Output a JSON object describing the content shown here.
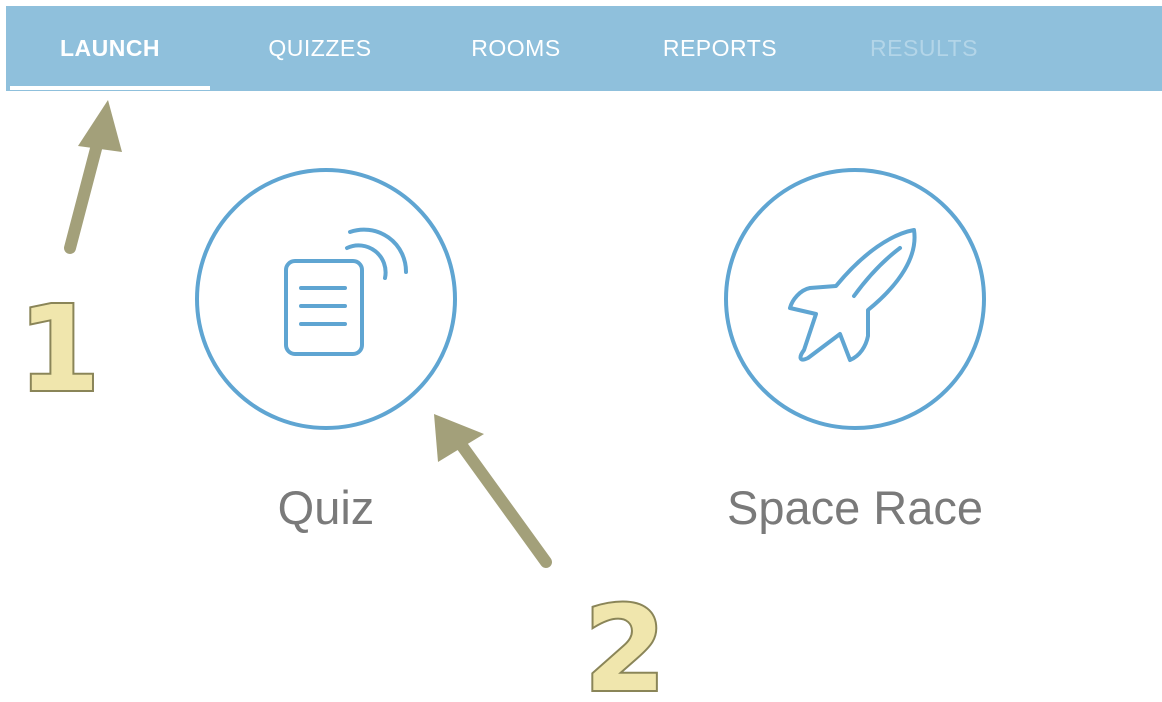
{
  "nav": {
    "tabs": [
      {
        "label": "LAUNCH",
        "state": "active"
      },
      {
        "label": "QUIZZES",
        "state": "normal"
      },
      {
        "label": "ROOMS",
        "state": "normal"
      },
      {
        "label": "REPORTS",
        "state": "normal"
      },
      {
        "label": "RESULTS",
        "state": "disabled"
      }
    ]
  },
  "modes": [
    {
      "label": "Quiz",
      "icon": "quiz-device-icon"
    },
    {
      "label": "Space Race",
      "icon": "rocket-icon"
    }
  ],
  "annotations": {
    "step1": "1",
    "step2": "2"
  },
  "colors": {
    "nav_bg": "#8fc0dc",
    "icon_blue": "#5fa5d2",
    "label_gray": "#7a7a7a",
    "arrow": "#a3a07a",
    "annotation_fill": "#f0e6ad",
    "annotation_stroke": "#8a8558"
  }
}
